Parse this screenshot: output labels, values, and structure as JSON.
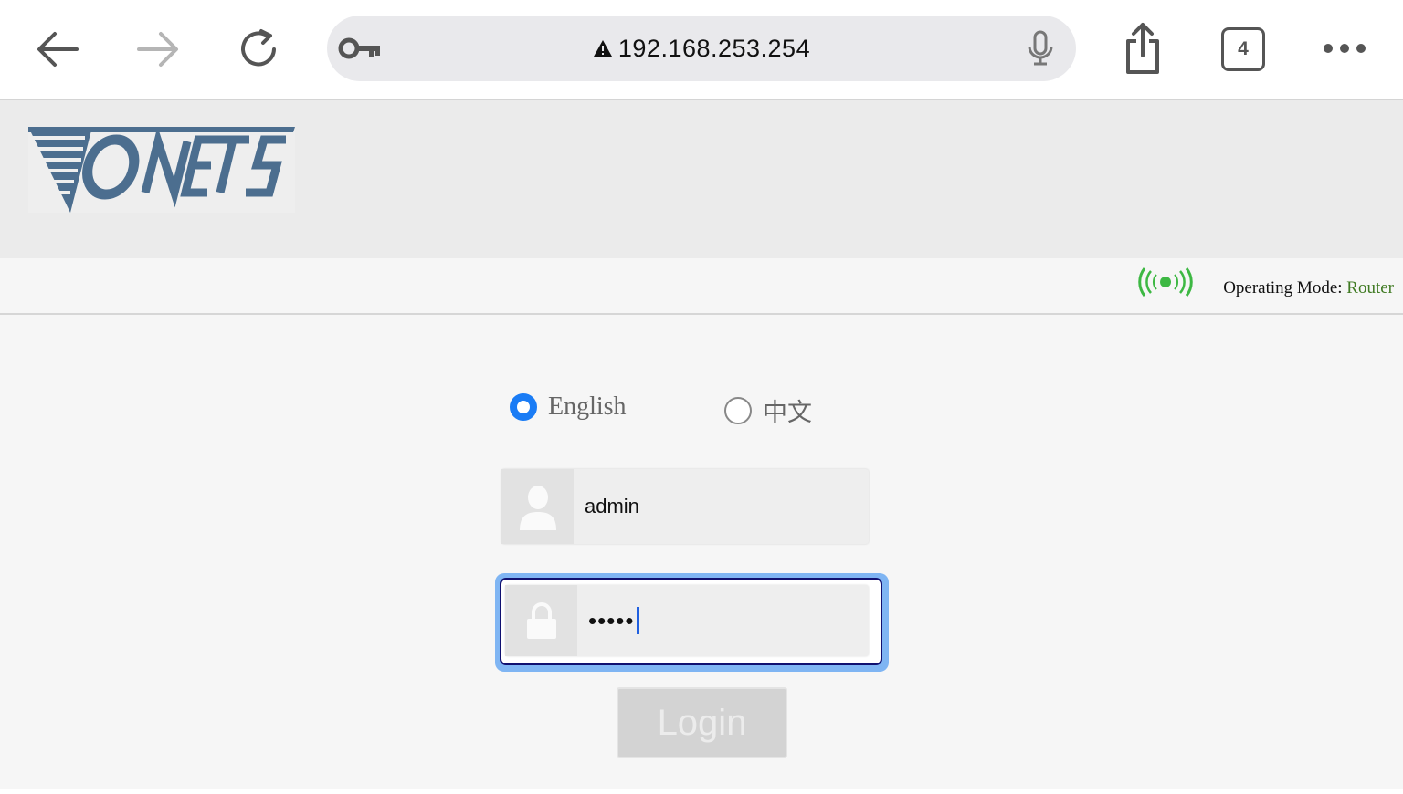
{
  "browser": {
    "url": "192.168.253.254",
    "tab_count": "4",
    "accent_color": "#1a7cf5"
  },
  "logo": {
    "text": "VONETS"
  },
  "status": {
    "operating_mode_label": "Operating Mode: ",
    "operating_mode_value": "Router"
  },
  "language": {
    "options": [
      {
        "label": "English",
        "selected": true
      },
      {
        "label": "中文",
        "selected": false
      }
    ]
  },
  "login": {
    "username": "admin",
    "password_masked": "•••••",
    "button_label": "Login"
  }
}
